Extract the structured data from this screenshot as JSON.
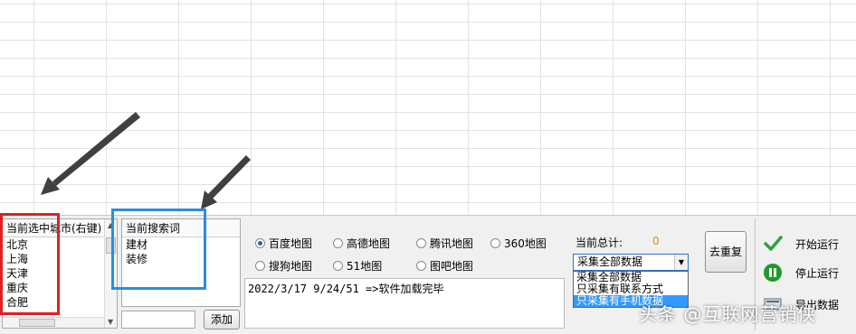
{
  "cities": {
    "header": "当前选中城市(右键)",
    "items": [
      "北京",
      "上海",
      "天津",
      "重庆",
      "合肥"
    ]
  },
  "keywords": {
    "header": "当前搜索词",
    "items": [
      "建材",
      "装修"
    ],
    "add_input": "",
    "add_label": "添加"
  },
  "maps": {
    "options": [
      "百度地图",
      "高德地图",
      "腾讯地图",
      "360地图",
      "搜狗地图",
      "51地图",
      "图吧地图"
    ],
    "selected": "百度地图"
  },
  "total": {
    "label": "当前总计:",
    "value": "0"
  },
  "dedupe_label": "去重复",
  "mode": {
    "selected": "采集全部数据",
    "options": [
      "采集全部数据",
      "只采集有联系方式",
      "只采集有手机数据"
    ],
    "highlighted": "只采集有手机数据"
  },
  "log": [
    "2022/3/17 9/24/51 =>软件加载完毕"
  ],
  "controls": {
    "start_label": "开始运行",
    "stop_label": "停止运行",
    "third_label": "导出数据"
  },
  "watermark": "头条 @互联网营销侠",
  "colors": {
    "red_box": "#e02020",
    "blue_box": "#2a8ee0",
    "total_value": "#e48a1a",
    "start_icon": "#2ea043",
    "stop_icon": "#1f9a2a"
  }
}
